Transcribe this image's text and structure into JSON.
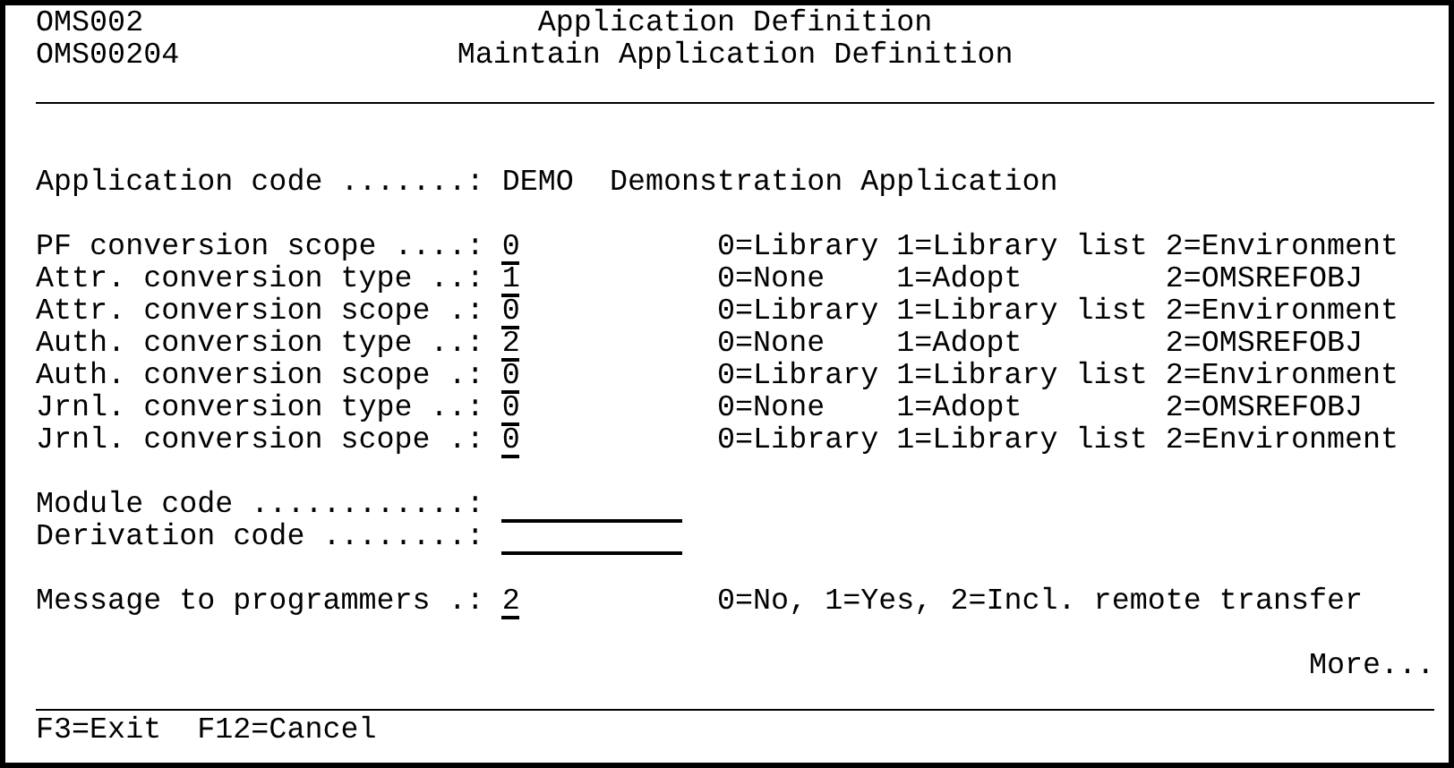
{
  "header": {
    "program_id": "OMS002",
    "format_id": "OMS00204",
    "title": "Application Definition",
    "subtitle": "Maintain Application Definition"
  },
  "application": {
    "label": "Application code .......:",
    "code": "DEMO",
    "description": "Demonstration Application"
  },
  "options": [
    {
      "label": "PF conversion scope ....:",
      "value": "0",
      "choices": [
        "0=Library",
        "1=Library list",
        "2=Environment"
      ]
    },
    {
      "label": "Attr. conversion type ..:",
      "value": "1",
      "choices": [
        "0=None",
        "1=Adopt",
        "2=OMSREFOBJ"
      ]
    },
    {
      "label": "Attr. conversion scope .:",
      "value": "0",
      "choices": [
        "0=Library",
        "1=Library list",
        "2=Environment"
      ]
    },
    {
      "label": "Auth. conversion type ..:",
      "value": "2",
      "choices": [
        "0=None",
        "1=Adopt",
        "2=OMSREFOBJ"
      ]
    },
    {
      "label": "Auth. conversion scope .:",
      "value": "0",
      "choices": [
        "0=Library",
        "1=Library list",
        "2=Environment"
      ]
    },
    {
      "label": "Jrnl. conversion type ..:",
      "value": "0",
      "choices": [
        "0=None",
        "1=Adopt",
        "2=OMSREFOBJ"
      ]
    },
    {
      "label": "Jrnl. conversion scope .:",
      "value": "0",
      "choices": [
        "0=Library",
        "1=Library list",
        "2=Environment"
      ]
    }
  ],
  "code_fields": [
    {
      "label": "Module code ............:"
    },
    {
      "label": "Derivation code ........:"
    }
  ],
  "message": {
    "label": "Message to programmers .:",
    "value": "2",
    "help": "0=No, 1=Yes, 2=Incl. remote transfer"
  },
  "more": "More...",
  "function_keys": [
    "F3=Exit",
    "F12=Cancel"
  ]
}
